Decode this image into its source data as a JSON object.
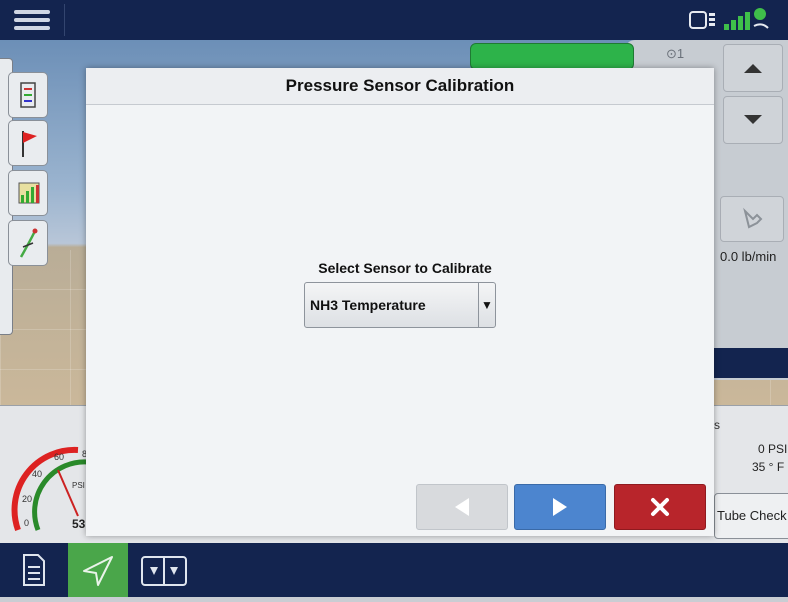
{
  "colors": {
    "topbar": "#13244f",
    "accent_green": "#2db34a",
    "nav_active": "#4aa64a",
    "next_button": "#4c85cf",
    "cancel_button": "#b8252b"
  },
  "top_bar": {
    "menu_icon": "hamburger-menu-icon",
    "status_icons": [
      "display-device-icon",
      "gps-satellite-icon"
    ]
  },
  "background": {
    "row_indicator": "⊙1",
    "rate_value": "0.0 lb/min",
    "gauge": {
      "ticks": [
        "0",
        "20",
        "40",
        "60",
        "8"
      ],
      "unit": "PSI",
      "value_partial": "53"
    },
    "side_letter": "s",
    "pressure_value": "0 PSI",
    "temperature_value": "35 ° F",
    "tube_check_label": "Tube Check"
  },
  "modal": {
    "title": "Pressure Sensor Calibration",
    "select_label": "Select Sensor to Calibrate",
    "select_value": "NH3 Temperature",
    "buttons": {
      "back_icon": "left-arrow-icon",
      "next_icon": "right-arrow-icon",
      "cancel_icon": "close-icon"
    }
  },
  "bottom_nav": {
    "items": [
      {
        "icon": "document-icon",
        "active": false
      },
      {
        "icon": "navigation-arrow-icon",
        "active": true
      },
      {
        "icon": "split-view-icon",
        "active": false
      }
    ]
  }
}
